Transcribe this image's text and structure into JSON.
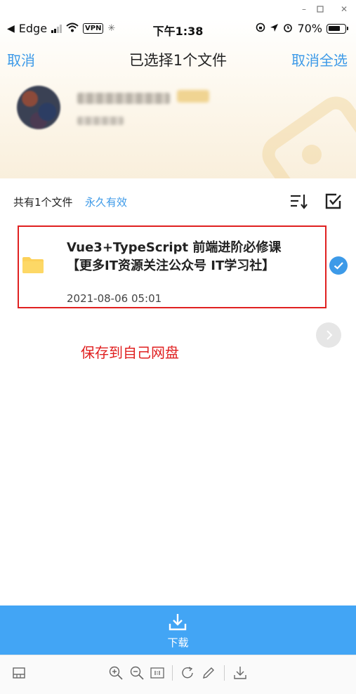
{
  "window_chrome": {
    "minimize_icon": "minimize-icon",
    "maximize_icon": "maximize-icon",
    "close_icon": "close-icon"
  },
  "status_bar": {
    "back_app": "Edge",
    "vpn": "VPN",
    "time": "下午1:38",
    "battery": "70%"
  },
  "nav": {
    "cancel": "取消",
    "title": "已选择1个文件",
    "cancel_all": "取消全选"
  },
  "file_list": {
    "count_label": "共有1个文件",
    "validity": "永久有效",
    "items": [
      {
        "name": "Vue3+TypeScript 前端进阶必修课 【更多IT资源关注公众号 IT学习社】",
        "date": "2021-08-06 05:01",
        "selected": true
      }
    ]
  },
  "annotation": {
    "save_note": "保存到自己网盘"
  },
  "download": {
    "label": "下载"
  },
  "colors": {
    "accent": "#3d9ae8",
    "download_bar": "#42a5f5",
    "annotation_red": "#e02020"
  }
}
